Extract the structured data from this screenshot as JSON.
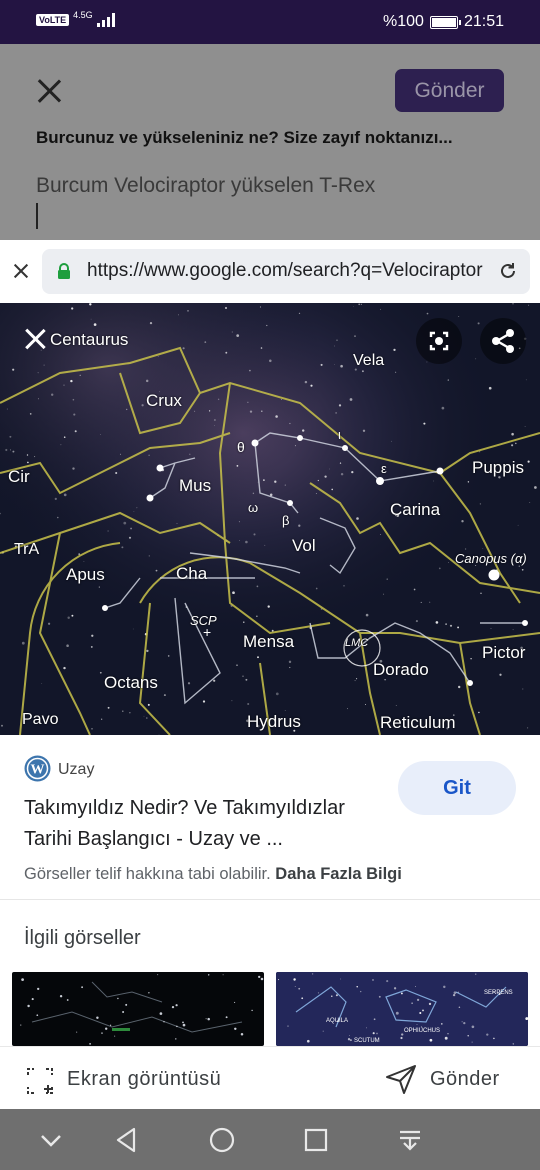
{
  "status_bar": {
    "volte": "VoLTE",
    "network": "4.5G",
    "battery_text": "%100",
    "battery_level": 1.0,
    "time": "21:51",
    "bg_color": "#231442"
  },
  "compose": {
    "close_icon": "close-icon",
    "send_label": "Gönder",
    "question": "Burcunuz ve yükseleniniz ne? Size zayıf noktanızı...",
    "answer_text": "Burcum Velociraptor yükselen T-Rex"
  },
  "browser": {
    "url": "https://www.google.com/search?q=Velociraptor",
    "lock_icon": "lock-icon",
    "reload_icon": "reload-icon"
  },
  "image_viewer": {
    "close_icon": "close-icon",
    "lens_icon": "lens-icon",
    "share_icon": "share-icon",
    "constellation_labels": [
      "Centaurus",
      "Vela",
      "Crux",
      "Cir",
      "Mus",
      "Puppis",
      "Carina",
      "TrA",
      "Vol",
      "Canopus (α)",
      "Apus",
      "Cha",
      "SCP",
      "Mensa",
      "LMC",
      "Dorado",
      "Pictor",
      "Octans",
      "Pavo",
      "Hydrus",
      "Reticulum",
      "θ",
      "ι",
      "ε",
      "ω",
      "β"
    ]
  },
  "result": {
    "source_name": "Uzay",
    "source_icon": "wordpress-icon",
    "title": "Takımyıldız Nedir? Ve Takımyıldızlar Tarihi Başlangıcı - Uzay ve ...",
    "visit_label": "Git",
    "copyright_text": "Görseller telif hakkına tabi olabilir.",
    "more_info_label": "Daha Fazla Bilgi",
    "accent_color": "#1a56c8"
  },
  "related": {
    "title": "İlgili görseller",
    "thumbs": [
      {
        "labels": []
      },
      {
        "labels": [
          "SERPENS",
          "AQUILA",
          "OPHIUCHUS",
          "SCUTUM"
        ]
      }
    ]
  },
  "action_bar": {
    "screenshot_label": "Ekran görüntüsü",
    "send_label": "Gönder"
  },
  "nav_bar": {
    "icons": [
      "chevron-down-icon",
      "back-icon",
      "home-icon",
      "recents-icon",
      "notification-shade-icon"
    ]
  }
}
